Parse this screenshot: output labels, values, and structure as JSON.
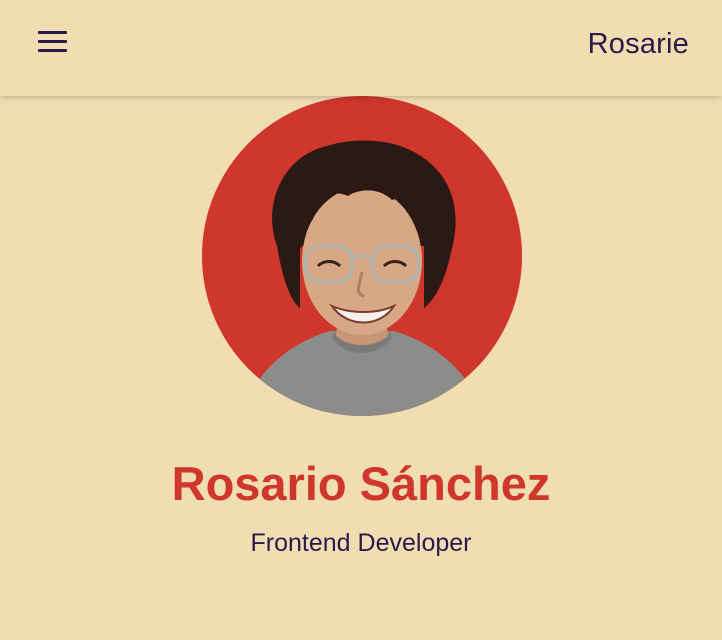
{
  "header": {
    "brand": "Rosarie",
    "menu_icon": "hamburger-menu-icon"
  },
  "profile": {
    "name": "Rosario Sánchez",
    "role": "Frontend Developer",
    "photo_background": "#cf362c"
  },
  "colors": {
    "background": "#f0ddb2",
    "accent": "#cf362c",
    "text": "#2a1a4b"
  }
}
